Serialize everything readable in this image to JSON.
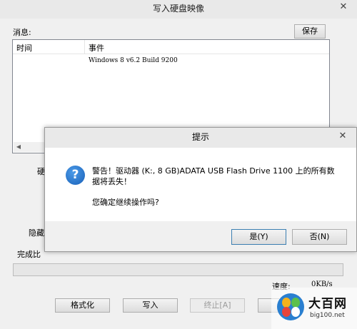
{
  "main_window": {
    "title": "写入硬盘映像",
    "close_glyph": "✕",
    "messages_label": "消息:",
    "save_label": "保存",
    "log": {
      "columns": [
        "时间",
        "事件"
      ],
      "rows": [
        {
          "time": "",
          "event": "Windows 8 v6.2 Build 9200"
        }
      ]
    },
    "disk_label": "硬",
    "hide_label": "隐藏",
    "progress_label": "完成比",
    "progress_fraction": 0,
    "speed_label": "速度:",
    "speed_value": "0KB/s",
    "buttons": {
      "format": "格式化",
      "write": "写入",
      "stop": "终止[A]"
    }
  },
  "dialog": {
    "title": "提示",
    "close_glyph": "✕",
    "icon": "question-icon",
    "icon_glyph": "?",
    "warning_line1": "警告！驱动器 (K:, 8 GB)ADATA   USB Flash Drive 1100 上的所有数",
    "warning_line2": "据将丢失！",
    "confirm": "您确定继续操作吗?",
    "yes_label": "是(Y)",
    "no_label": "否(N)"
  },
  "watermark": {
    "title": "大百网",
    "url": "big100.net"
  }
}
